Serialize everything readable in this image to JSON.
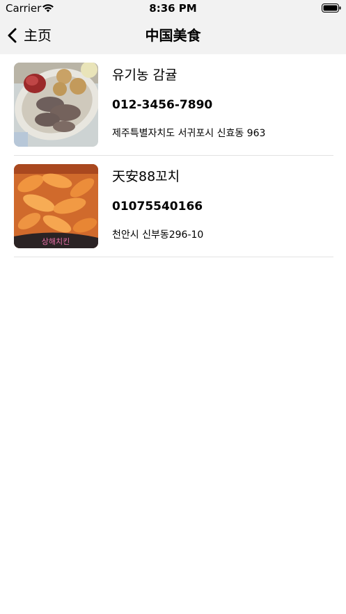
{
  "status_bar": {
    "carrier": "Carrier",
    "time": "8:36 PM"
  },
  "nav": {
    "back_label": "主页",
    "title": "中国美食"
  },
  "restaurants": [
    {
      "name": "유기농 감귤",
      "phone": "012-3456-7890",
      "address": "제주특별자치도 서귀포시 신효동 963",
      "image": "grilled-sausage-platter-photo"
    },
    {
      "name": "天安88꼬치",
      "phone": "01075540166",
      "address": "천안시 신부동296-10",
      "image": "fried-chicken-photo"
    }
  ]
}
